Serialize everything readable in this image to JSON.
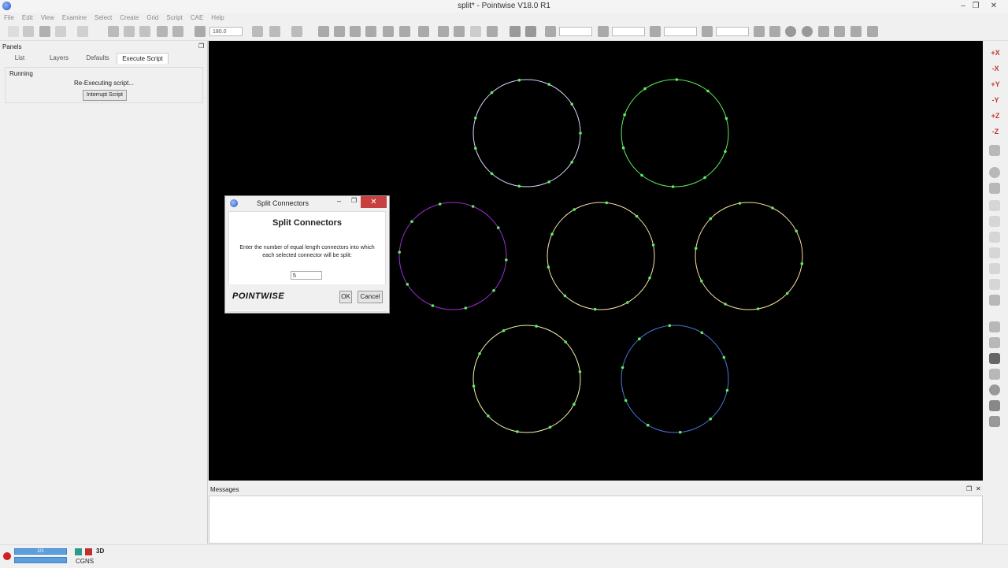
{
  "app": {
    "title": "split* - Pointwise V18.0 R1",
    "window_controls": [
      "–",
      "❐",
      "✕"
    ]
  },
  "menu": [
    "File",
    "Edit",
    "View",
    "Examine",
    "Select",
    "Create",
    "Grid",
    "Script",
    "CAE",
    "Help"
  ],
  "toolbar": {
    "angle_value": "180.0"
  },
  "panel": {
    "title": "Panels",
    "tabs": [
      "List",
      "Layers",
      "Defaults",
      "Execute Script"
    ],
    "active_tab": "Execute Script",
    "status_label": "Running",
    "status_text": "Re-Executing script...",
    "interrupt_button": "Interrupt Script"
  },
  "view_axes": [
    "+X",
    "-X",
    "+Y",
    "-Y",
    "+Z",
    "-Z"
  ],
  "circles": [
    {
      "color": "#d8d8ff",
      "points": 11
    },
    {
      "color": "#5cf05c",
      "points": 10
    },
    {
      "color": "#9b30d6",
      "points": 10
    },
    {
      "color": "#f4e6b0",
      "points": 10
    },
    {
      "color": "#f7e3a0",
      "points": 10
    },
    {
      "color": "#f6f6b2",
      "points": 10
    },
    {
      "color": "#4a78d8",
      "points": 10
    }
  ],
  "node_color": "#5cf05c",
  "dialog": {
    "window_title": "Split Connectors",
    "heading": "Split Connectors",
    "prompt": "Enter the number of equal length connectors into which each selected connector will be split:",
    "input_value": "5",
    "logo": "POINTWISE",
    "ok": "OK",
    "cancel": "Cancel"
  },
  "messages": {
    "title": "Messages"
  },
  "status": {
    "progress": "1/1",
    "mode": "3D",
    "solver": "CGNS"
  }
}
